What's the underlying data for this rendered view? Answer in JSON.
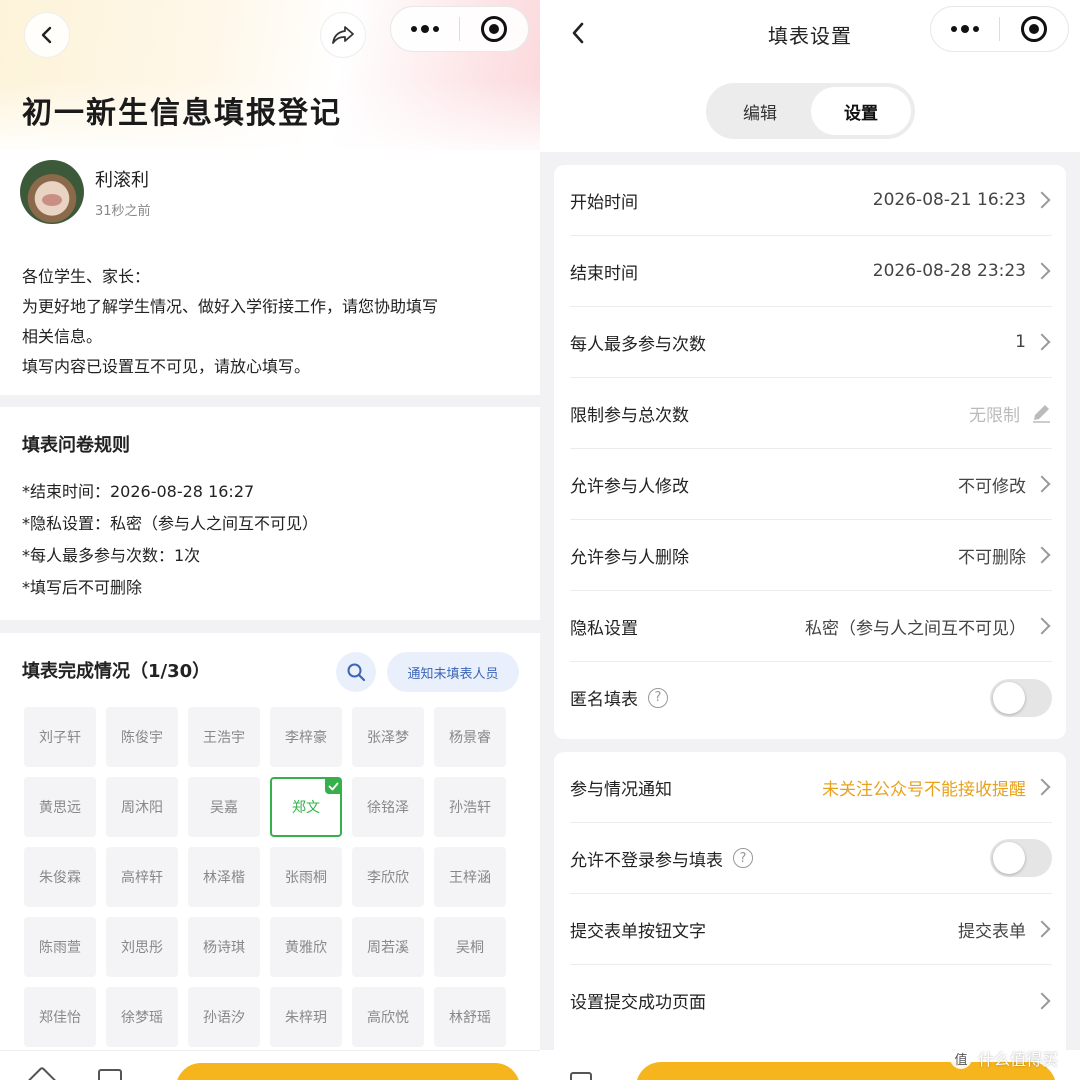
{
  "left": {
    "title": "初一新生信息填报登记",
    "author": "利滚利",
    "time_ago": "31秒之前",
    "intro": [
      "各位学生、家长：",
      "为更好地了解学生情况、做好入学衔接工作，请您协助填写",
      "相关信息。",
      "填写内容已设置互不可见，请放心填写。"
    ],
    "rules_title": "填表问卷规则",
    "rules": [
      "*结束时间：2026-08-28 16:27",
      "*隐私设置：私密（参与人之间互不可见）",
      "*每人最多参与次数：1次",
      "*填写后不可删除"
    ],
    "progress_title": "填表完成情况（1/30）",
    "notify_label": "通知未填表人员",
    "names": [
      "刘子轩",
      "陈俊宇",
      "王浩宇",
      "李梓豪",
      "张泽梦",
      "杨景睿",
      "黄思远",
      "周沐阳",
      "吴嘉",
      "郑文",
      "徐铭泽",
      "孙浩轩",
      "朱俊霖",
      "高梓轩",
      "林泽楷",
      "张雨桐",
      "李欣欣",
      "王梓涵",
      "陈雨萱",
      "刘思彤",
      "杨诗琪",
      "黄雅欣",
      "周若溪",
      "吴桐",
      "郑佳怡",
      "徐梦瑶",
      "孙语汐",
      "朱梓玥",
      "高欣悦",
      "林舒瑶"
    ],
    "completed_name": "郑文"
  },
  "right": {
    "title": "填表设置",
    "tabs": [
      "编辑",
      "设置"
    ],
    "active_tab": "设置",
    "group1": [
      {
        "label": "开始时间",
        "value": "2026-08-21 16:23"
      },
      {
        "label": "结束时间",
        "value": "2026-08-28 23:23"
      },
      {
        "label": "每人最多参与次数",
        "value": "1"
      },
      {
        "label": "限制参与总次数",
        "value": "无限制"
      },
      {
        "label": "允许参与人修改",
        "value": "不可修改"
      },
      {
        "label": "允许参与人删除",
        "value": "不可删除"
      },
      {
        "label": "隐私设置",
        "value": "私密（参与人之间互不可见）"
      },
      {
        "label": "匿名填表",
        "value": ""
      }
    ],
    "group2": [
      {
        "label": "参与情况通知",
        "value": "未关注公众号不能接收提醒"
      },
      {
        "label": "允许不登录参与填表",
        "value": ""
      },
      {
        "label": "提交表单按钮文字",
        "value": "提交表单"
      },
      {
        "label": "设置提交成功页面",
        "value": ""
      }
    ],
    "accent_warn": "#e8a21d"
  },
  "watermark": "什么值得买"
}
